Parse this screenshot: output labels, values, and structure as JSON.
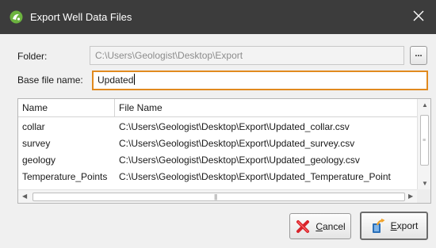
{
  "window": {
    "title": "Export Well Data Files",
    "close_glyph": "✕"
  },
  "form": {
    "folder_label": "Folder:",
    "folder_value": "C:\\Users\\Geologist\\Desktop\\Export",
    "browse_label": "...",
    "basename_label": "Base file name:",
    "basename_value": "Updated"
  },
  "table": {
    "columns": [
      "Name",
      "File Name"
    ],
    "rows": [
      {
        "name": "collar",
        "file": "C:\\Users\\Geologist\\Desktop\\Export\\Updated_collar.csv"
      },
      {
        "name": "survey",
        "file": "C:\\Users\\Geologist\\Desktop\\Export\\Updated_survey.csv"
      },
      {
        "name": "geology",
        "file": "C:\\Users\\Geologist\\Desktop\\Export\\Updated_geology.csv"
      },
      {
        "name": "Temperature_Points",
        "file": "C:\\Users\\Geologist\\Desktop\\Export\\Updated_Temperature_Point"
      }
    ]
  },
  "buttons": {
    "cancel_access": "C",
    "cancel_rest": "ancel",
    "export_access": "E",
    "export_rest": "xport"
  },
  "icons": {
    "app": "leapfrog-logo-icon",
    "close": "close-icon",
    "cancel": "red-x-icon",
    "export": "export-arrow-icon"
  },
  "colors": {
    "titlebar": "#3c3c3c",
    "focus_border": "#e18a1f",
    "app_icon": "#6cb33f"
  }
}
